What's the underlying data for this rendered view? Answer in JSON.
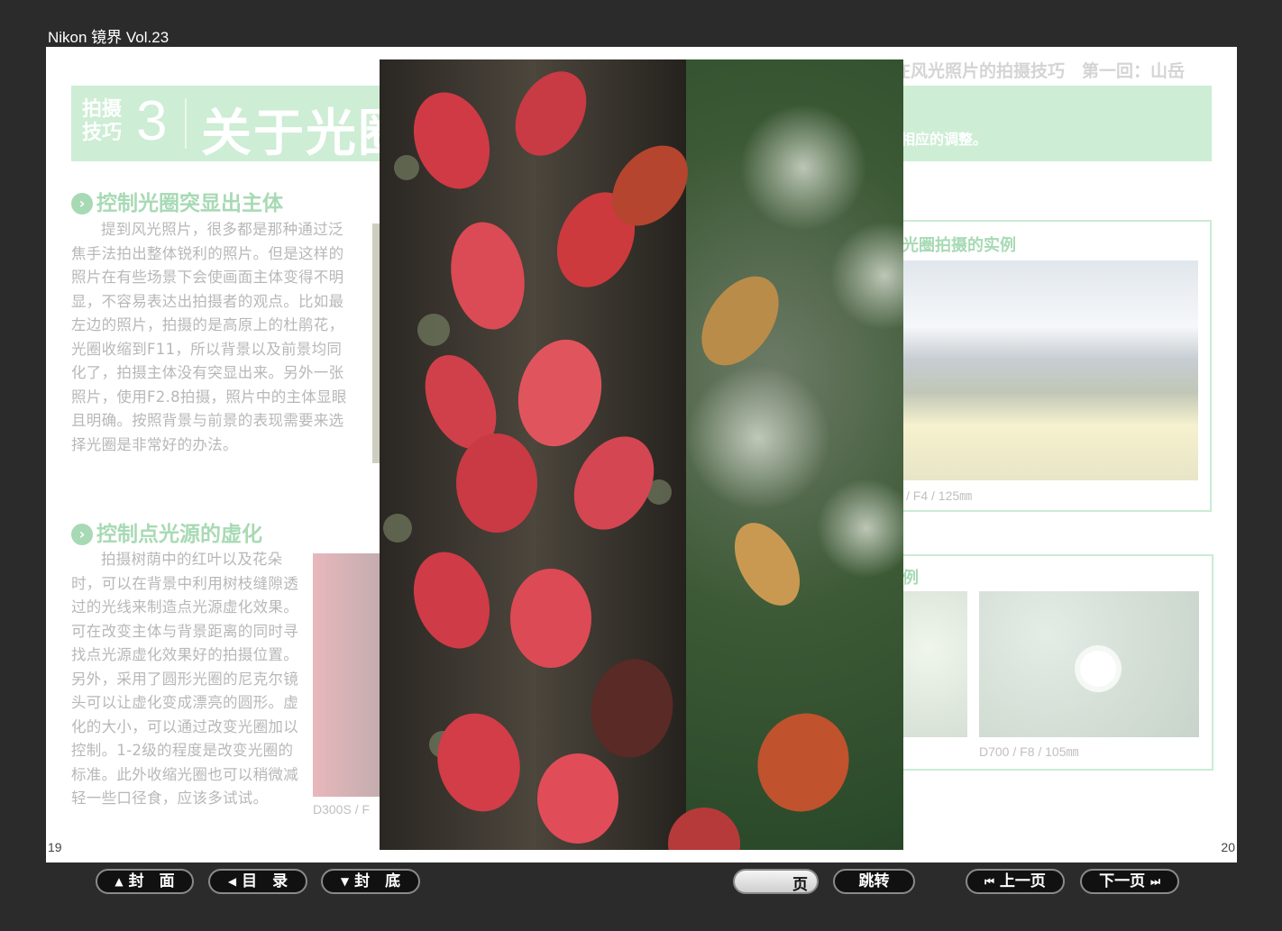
{
  "app": {
    "title": "Nikon 镜界 Vol.23"
  },
  "spread": {
    "series_title": "在风光照片的拍摄技巧　第一回：山岳",
    "header": {
      "kicker_line1": "拍摄",
      "kicker_line2": "技巧",
      "number": "3",
      "title": "关于光圈",
      "desc": "相应的调整。"
    },
    "section1": {
      "heading": "控制光圈突显出主体",
      "body": "提到风光照片，很多都是那种通过泛焦手法拍出整体锐利的照片。但是这样的照片在有些场景下会使画面主体变得不明显，不容易表达出拍摄者的观点。比如最左边的照片，拍摄的是高原上的杜鹃花，光圈收缩到F11，所以背景以及前景均同化了，拍摄主体没有突显出来。另外一张照片，使用F2.8拍摄，照片中的主体显眼且明确。按照背景与前景的表现需要来选择光圈是非常好的办法。"
    },
    "section2": {
      "heading": "控制点光源的虚化",
      "body": "拍摄树荫中的红叶以及花朵时，可以在背景中利用树枝缝隙透过的光线来制造点光源虚化效果。可在改变主体与背景距离的同时寻找点光源虚化效果好的拍摄位置。另外，采用了圆形光圈的尼克尔镜头可以让虚化变成漂亮的圆形。虚化的大小，可以通过改变光圈加以控制。1-2级的程度是改变光圈的标准。此外收缩光圈也可以稍微减轻一些口径食，应该多试试。",
      "caption": "D300S / F"
    },
    "box1": {
      "title": "光圈拍摄的实例",
      "caption": "/ F4 / 125㎜"
    },
    "box2": {
      "title": "例",
      "caption": "D700 / F8 / 105㎜"
    },
    "page_left": "19",
    "page_right": "20"
  },
  "overlay": {
    "subject": "red-ivy-on-tree-trunk-photo"
  },
  "toolbar": {
    "cover": "封　面",
    "toc": "目　录",
    "back": "封　底",
    "page_unit": "页",
    "page_value": "",
    "jump": "跳转",
    "prev": "上一页",
    "next": "下一页",
    "icons": {
      "cover": "up-triangle-icon",
      "toc": "left-triangle-icon",
      "back": "down-triangle-icon",
      "prev": "skip-back-icon",
      "next": "skip-forward-icon"
    }
  }
}
